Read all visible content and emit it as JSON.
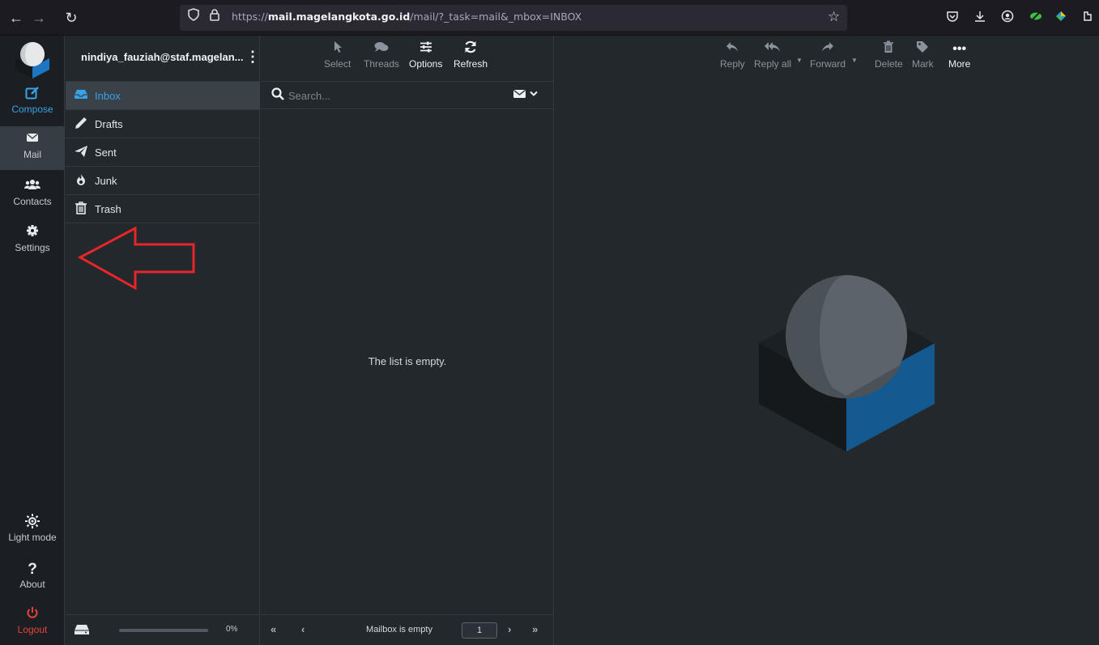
{
  "browser": {
    "url_prefix": "https://",
    "url_domain": "mail.magelangkota.go.id",
    "url_path": "/mail/?_task=mail&_mbox=INBOX"
  },
  "account": {
    "email": "nindiya_fauziah@staf.magelan..."
  },
  "rail": {
    "compose": "Compose",
    "mail": "Mail",
    "contacts": "Contacts",
    "settings": "Settings",
    "light_mode": "Light mode",
    "about": "About",
    "logout": "Logout"
  },
  "folders": [
    {
      "label": "Inbox",
      "icon": "inbox-icon"
    },
    {
      "label": "Drafts",
      "icon": "pencil-icon"
    },
    {
      "label": "Sent",
      "icon": "paper-plane-icon"
    },
    {
      "label": "Junk",
      "icon": "fire-icon"
    },
    {
      "label": "Trash",
      "icon": "trash-icon"
    }
  ],
  "quota": {
    "percent_label": "0%",
    "fraction": 0.0
  },
  "list_toolbar": {
    "select": "Select",
    "threads": "Threads",
    "options": "Options",
    "refresh": "Refresh"
  },
  "search": {
    "placeholder": "Search..."
  },
  "list": {
    "empty_message": "The list is empty."
  },
  "pager": {
    "status": "Mailbox is empty",
    "page": "1"
  },
  "message_toolbar": {
    "reply": "Reply",
    "reply_all": "Reply all",
    "forward": "Forward",
    "delete": "Delete",
    "mark": "Mark",
    "more": "More"
  },
  "colors": {
    "accent": "#37a2e6",
    "danger": "#e8423b",
    "background": "#22282c",
    "rail": "#1b1f23",
    "annotation": "#e8252a"
  }
}
